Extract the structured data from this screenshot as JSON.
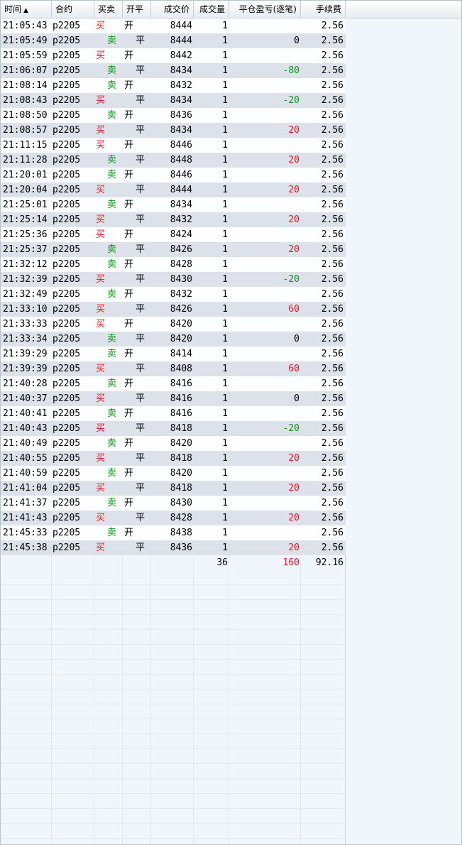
{
  "header": {
    "time": "时间",
    "sort_indicator": "▲",
    "contract": "合约",
    "side": "买卖",
    "open_close": "开平",
    "price": "成交价",
    "volume": "成交量",
    "pnl": "平仓盈亏(逐笔)",
    "fee": "手续费"
  },
  "colors": {
    "buy": "#e8141c",
    "sell": "#0a9a10",
    "alt_row": "#dde2ea"
  },
  "trades": [
    {
      "time": "21:05:43",
      "contract": "p2205",
      "side": "买",
      "oc": "开",
      "price": "8444",
      "vol": "1",
      "pnl": "",
      "fee": "2.56"
    },
    {
      "time": "21:05:49",
      "contract": "p2205",
      "side": "卖",
      "oc": "平",
      "price": "8444",
      "vol": "1",
      "pnl": "0",
      "fee": "2.56"
    },
    {
      "time": "21:05:59",
      "contract": "p2205",
      "side": "买",
      "oc": "开",
      "price": "8442",
      "vol": "1",
      "pnl": "",
      "fee": "2.56"
    },
    {
      "time": "21:06:07",
      "contract": "p2205",
      "side": "卖",
      "oc": "平",
      "price": "8434",
      "vol": "1",
      "pnl": "-80",
      "fee": "2.56"
    },
    {
      "time": "21:08:14",
      "contract": "p2205",
      "side": "卖",
      "oc": "开",
      "price": "8432",
      "vol": "1",
      "pnl": "",
      "fee": "2.56"
    },
    {
      "time": "21:08:43",
      "contract": "p2205",
      "side": "买",
      "oc": "平",
      "price": "8434",
      "vol": "1",
      "pnl": "-20",
      "fee": "2.56"
    },
    {
      "time": "21:08:50",
      "contract": "p2205",
      "side": "卖",
      "oc": "开",
      "price": "8436",
      "vol": "1",
      "pnl": "",
      "fee": "2.56"
    },
    {
      "time": "21:08:57",
      "contract": "p2205",
      "side": "买",
      "oc": "平",
      "price": "8434",
      "vol": "1",
      "pnl": "20",
      "fee": "2.56"
    },
    {
      "time": "21:11:15",
      "contract": "p2205",
      "side": "买",
      "oc": "开",
      "price": "8446",
      "vol": "1",
      "pnl": "",
      "fee": "2.56"
    },
    {
      "time": "21:11:28",
      "contract": "p2205",
      "side": "卖",
      "oc": "平",
      "price": "8448",
      "vol": "1",
      "pnl": "20",
      "fee": "2.56"
    },
    {
      "time": "21:20:01",
      "contract": "p2205",
      "side": "卖",
      "oc": "开",
      "price": "8446",
      "vol": "1",
      "pnl": "",
      "fee": "2.56"
    },
    {
      "time": "21:20:04",
      "contract": "p2205",
      "side": "买",
      "oc": "平",
      "price": "8444",
      "vol": "1",
      "pnl": "20",
      "fee": "2.56"
    },
    {
      "time": "21:25:01",
      "contract": "p2205",
      "side": "卖",
      "oc": "开",
      "price": "8434",
      "vol": "1",
      "pnl": "",
      "fee": "2.56"
    },
    {
      "time": "21:25:14",
      "contract": "p2205",
      "side": "买",
      "oc": "平",
      "price": "8432",
      "vol": "1",
      "pnl": "20",
      "fee": "2.56"
    },
    {
      "time": "21:25:36",
      "contract": "p2205",
      "side": "买",
      "oc": "开",
      "price": "8424",
      "vol": "1",
      "pnl": "",
      "fee": "2.56"
    },
    {
      "time": "21:25:37",
      "contract": "p2205",
      "side": "卖",
      "oc": "平",
      "price": "8426",
      "vol": "1",
      "pnl": "20",
      "fee": "2.56"
    },
    {
      "time": "21:32:12",
      "contract": "p2205",
      "side": "卖",
      "oc": "开",
      "price": "8428",
      "vol": "1",
      "pnl": "",
      "fee": "2.56"
    },
    {
      "time": "21:32:39",
      "contract": "p2205",
      "side": "买",
      "oc": "平",
      "price": "8430",
      "vol": "1",
      "pnl": "-20",
      "fee": "2.56"
    },
    {
      "time": "21:32:49",
      "contract": "p2205",
      "side": "卖",
      "oc": "开",
      "price": "8432",
      "vol": "1",
      "pnl": "",
      "fee": "2.56"
    },
    {
      "time": "21:33:10",
      "contract": "p2205",
      "side": "买",
      "oc": "平",
      "price": "8426",
      "vol": "1",
      "pnl": "60",
      "fee": "2.56"
    },
    {
      "time": "21:33:33",
      "contract": "p2205",
      "side": "买",
      "oc": "开",
      "price": "8420",
      "vol": "1",
      "pnl": "",
      "fee": "2.56"
    },
    {
      "time": "21:33:34",
      "contract": "p2205",
      "side": "卖",
      "oc": "平",
      "price": "8420",
      "vol": "1",
      "pnl": "0",
      "fee": "2.56"
    },
    {
      "time": "21:39:29",
      "contract": "p2205",
      "side": "卖",
      "oc": "开",
      "price": "8414",
      "vol": "1",
      "pnl": "",
      "fee": "2.56"
    },
    {
      "time": "21:39:39",
      "contract": "p2205",
      "side": "买",
      "oc": "平",
      "price": "8408",
      "vol": "1",
      "pnl": "60",
      "fee": "2.56"
    },
    {
      "time": "21:40:28",
      "contract": "p2205",
      "side": "卖",
      "oc": "开",
      "price": "8416",
      "vol": "1",
      "pnl": "",
      "fee": "2.56"
    },
    {
      "time": "21:40:37",
      "contract": "p2205",
      "side": "买",
      "oc": "平",
      "price": "8416",
      "vol": "1",
      "pnl": "0",
      "fee": "2.56"
    },
    {
      "time": "21:40:41",
      "contract": "p2205",
      "side": "卖",
      "oc": "开",
      "price": "8416",
      "vol": "1",
      "pnl": "",
      "fee": "2.56"
    },
    {
      "time": "21:40:43",
      "contract": "p2205",
      "side": "买",
      "oc": "平",
      "price": "8418",
      "vol": "1",
      "pnl": "-20",
      "fee": "2.56"
    },
    {
      "time": "21:40:49",
      "contract": "p2205",
      "side": "卖",
      "oc": "开",
      "price": "8420",
      "vol": "1",
      "pnl": "",
      "fee": "2.56"
    },
    {
      "time": "21:40:55",
      "contract": "p2205",
      "side": "买",
      "oc": "平",
      "price": "8418",
      "vol": "1",
      "pnl": "20",
      "fee": "2.56"
    },
    {
      "time": "21:40:59",
      "contract": "p2205",
      "side": "卖",
      "oc": "开",
      "price": "8420",
      "vol": "1",
      "pnl": "",
      "fee": "2.56"
    },
    {
      "time": "21:41:04",
      "contract": "p2205",
      "side": "买",
      "oc": "平",
      "price": "8418",
      "vol": "1",
      "pnl": "20",
      "fee": "2.56"
    },
    {
      "time": "21:41:37",
      "contract": "p2205",
      "side": "卖",
      "oc": "开",
      "price": "8430",
      "vol": "1",
      "pnl": "",
      "fee": "2.56"
    },
    {
      "time": "21:41:43",
      "contract": "p2205",
      "side": "买",
      "oc": "平",
      "price": "8428",
      "vol": "1",
      "pnl": "20",
      "fee": "2.56"
    },
    {
      "time": "21:45:33",
      "contract": "p2205",
      "side": "卖",
      "oc": "开",
      "price": "8438",
      "vol": "1",
      "pnl": "",
      "fee": "2.56"
    },
    {
      "time": "21:45:38",
      "contract": "p2205",
      "side": "买",
      "oc": "平",
      "price": "8436",
      "vol": "1",
      "pnl": "20",
      "fee": "2.56"
    }
  ],
  "totals": {
    "vol": "36",
    "pnl": "160",
    "fee": "92.16"
  }
}
